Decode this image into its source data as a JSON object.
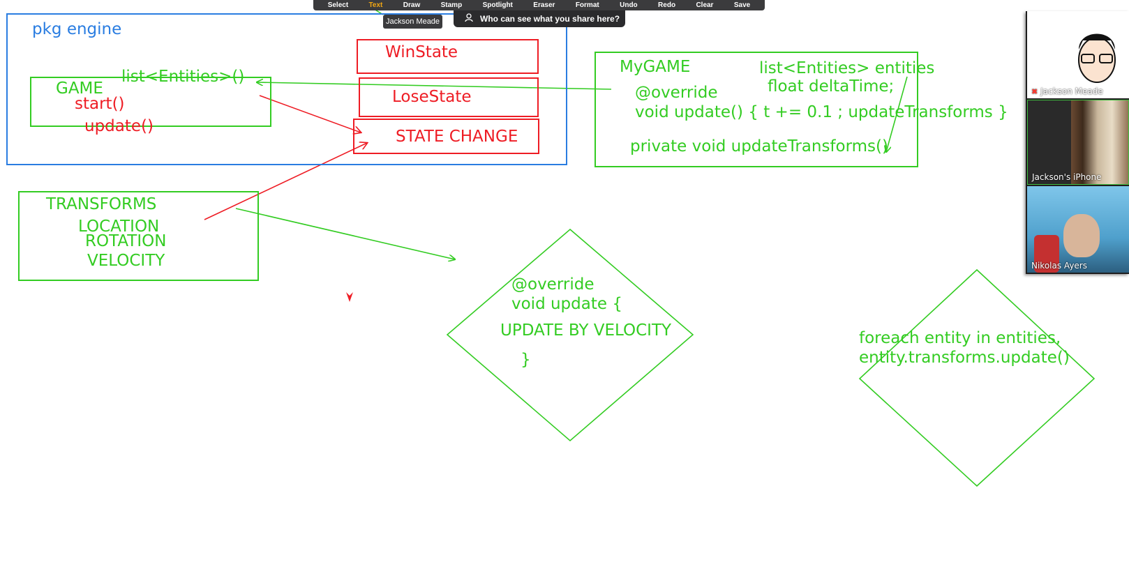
{
  "toolbar": {
    "items": [
      "Select",
      "Text",
      "Draw",
      "Stamp",
      "Spotlight",
      "Eraser",
      "Format",
      "Undo",
      "Redo",
      "Clear",
      "Save"
    ],
    "active": "Text",
    "tooltip": "Jackson Meade"
  },
  "share_notice": "Who can see what you share here?",
  "whiteboard": {
    "pkg_label": "pkg engine",
    "game": {
      "title": "GAME",
      "list": "list<Entities>()",
      "start": "start()",
      "update": "update()"
    },
    "states": {
      "win": "WinState",
      "lose": "LoseState",
      "change": "STATE CHANGE"
    },
    "transforms": {
      "title": "TRANSFORMS",
      "location": "LOCATION",
      "rotation": "ROTATION",
      "velocity": "VELOCITY"
    },
    "mygame": {
      "title": "MyGAME",
      "list": "list<Entities> entities",
      "float": "float deltaTime;",
      "override": "@override",
      "update": "void update() {  t += 0.1 ; updateTransforms  }",
      "private": "private void updateTransforms()"
    },
    "diamond1": {
      "override": "@override",
      "update": "void update {",
      "body": "UPDATE BY VELOCITY",
      "close": "}"
    },
    "diamond2": {
      "line1": "foreach entity in entities,",
      "line2": "entity.transforms.update()"
    }
  },
  "participants": [
    {
      "name": "Jackson Meade",
      "muted": true
    },
    {
      "name": "Jackson's iPhone"
    },
    {
      "name": "Nikolas Ayers"
    }
  ],
  "colors": {
    "green": "#33cc22",
    "red": "#ee1c24",
    "blue": "#2a7de1"
  }
}
